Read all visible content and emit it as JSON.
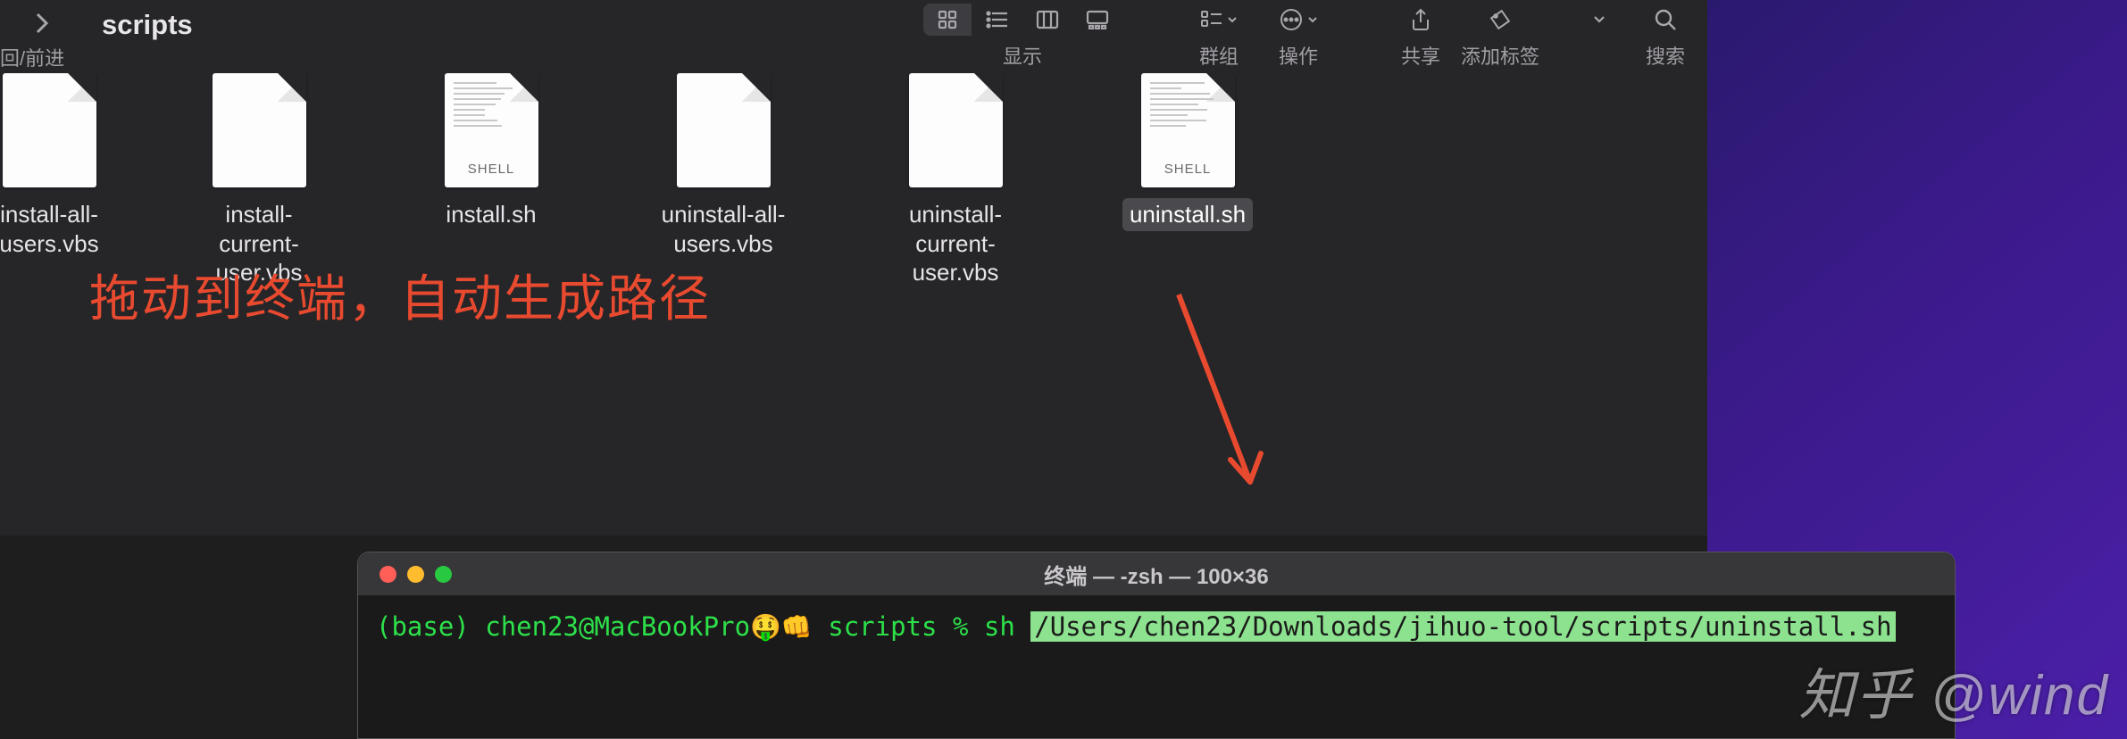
{
  "finder": {
    "folder_title": "scripts",
    "nav_caption": "回/前进",
    "toolbar": {
      "view_label": "显示",
      "group_label": "群组",
      "action_label": "操作",
      "share_label": "共享",
      "tags_label": "添加标签",
      "search_label": "搜索"
    },
    "files": [
      {
        "name": "install-all-users.vbs",
        "type": "vbs",
        "selected": false
      },
      {
        "name": "install-current-user.vbs",
        "type": "vbs",
        "selected": false
      },
      {
        "name": "install.sh",
        "type": "shell",
        "selected": false
      },
      {
        "name": "uninstall-all-users.vbs",
        "type": "vbs",
        "selected": false
      },
      {
        "name": "uninstall-current-user.vbs",
        "type": "vbs",
        "selected": false
      },
      {
        "name": "uninstall.sh",
        "type": "shell",
        "selected": true
      }
    ]
  },
  "annotation": {
    "text": "拖动到终端，自动生成路径"
  },
  "terminal": {
    "title": "终端 — -zsh — 100×36",
    "prompt_env": "(base)",
    "prompt_userhost": "chen23@MacBookPro",
    "prompt_emoji": "🤑👊",
    "prompt_dir": "scripts",
    "prompt_symbol": "%",
    "command": "sh",
    "path": "/Users/chen23/Downloads/jihuo-tool/scripts/uninstall.sh"
  },
  "watermark": "知乎 @wind",
  "shell_tag": "SHELL"
}
